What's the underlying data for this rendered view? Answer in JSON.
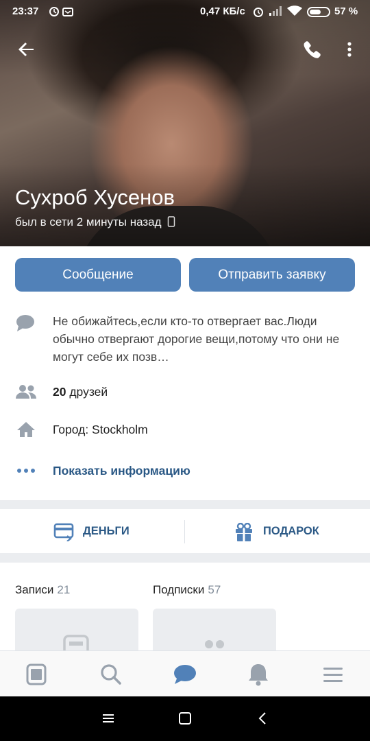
{
  "status_bar": {
    "time": "23:37",
    "speed": "0,47 КБ/с",
    "battery": "57 %"
  },
  "profile": {
    "name": "Сухроб Хусенов",
    "last_seen": "был в сети 2 минуты назад"
  },
  "actions": {
    "message": "Сообщение",
    "add_friend": "Отправить заявку"
  },
  "info": {
    "status": "Не обижайтесь,если кто-то отвергает вас.Люди обычно отвергают дорогие вещи,потому что они не могут себе их позв…",
    "friends_count": "20",
    "friends_label": "друзей",
    "city": "Город: Stockholm",
    "show_info": "Показать информацию"
  },
  "extras": {
    "money": "ДЕНЬГИ",
    "gift": "ПОДАРОК"
  },
  "sections": {
    "posts_label": "Записи",
    "posts_count": "21",
    "subs_label": "Подписки",
    "subs_count": "57"
  },
  "colors": {
    "accent": "#5181b8",
    "link": "#2a5885",
    "icon": "#99a2ad"
  },
  "icons": [
    "back-arrow-icon",
    "phone-icon",
    "more-vertical-icon",
    "comment-icon",
    "friends-icon",
    "home-icon",
    "dots-icon",
    "money-card-icon",
    "gift-icon",
    "news-icon",
    "search-icon",
    "messages-icon",
    "bell-icon",
    "menu-icon"
  ]
}
